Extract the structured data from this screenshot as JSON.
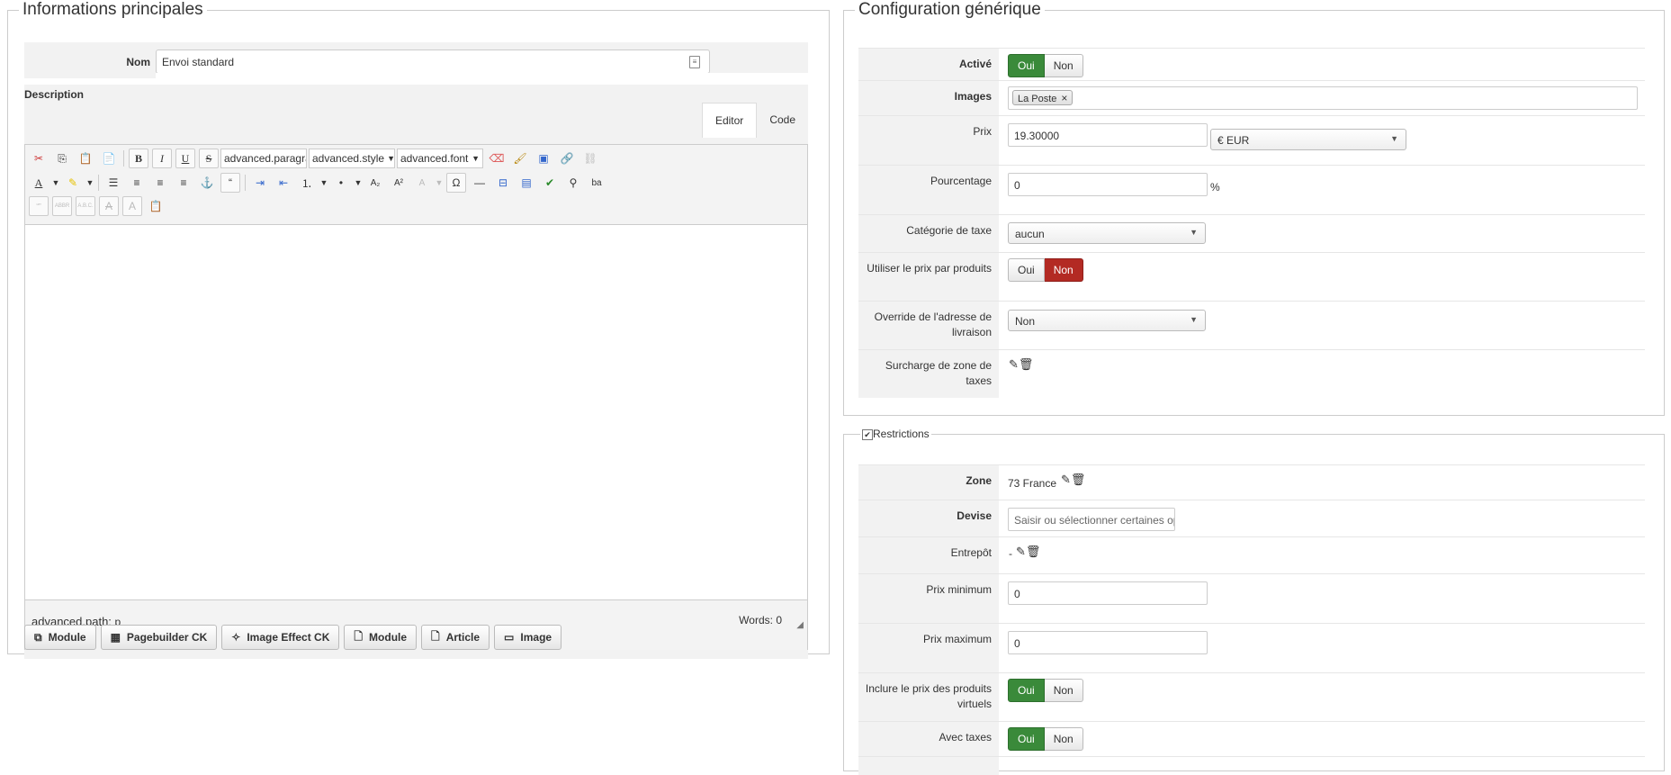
{
  "left": {
    "legend": "Informations principales",
    "nom_label": "Nom",
    "nom_value": "Envoi standard",
    "description_label": "Description",
    "tabs": [
      "Editor",
      "Code"
    ],
    "toolbar": {
      "dd1": "advanced.paragraph",
      "dd2": "advanced.style",
      "dd3": "advanced.font"
    },
    "status_path_label": "advanced.path:",
    "status_path_value": "p",
    "words_label": "Words:",
    "words_value": "0",
    "buttons": [
      "Module",
      "Pagebuilder CK",
      "Image Effect CK",
      "Module",
      "Article",
      "Image"
    ]
  },
  "gen": {
    "legend": "Configuration générique",
    "active_label": "Activé",
    "active_yes": "Oui",
    "active_no": "Non",
    "images_label": "Images",
    "images_tag": "La Poste",
    "prix_label": "Prix",
    "prix_value": "19.30000",
    "currency": "€ EUR",
    "pct_label": "Pourcentage",
    "pct_value": "0",
    "pct_unit": "%",
    "taxcat_label": "Catégorie de taxe",
    "taxcat_value": "aucun",
    "perprod_label": "Utiliser le prix par produits",
    "perprod_yes": "Oui",
    "perprod_no": "Non",
    "override_label": "Override de l'adresse de livraison",
    "override_value": "Non",
    "surcharge_label": "Surcharge de zone de taxes"
  },
  "restr": {
    "legend": "Restrictions",
    "zone_label": "Zone",
    "zone_value": "73 France",
    "devise_label": "Devise",
    "devise_placeholder": "Saisir ou sélectionner certaines options",
    "entrepot_label": "Entrepôt",
    "entrepot_value": "-",
    "prixmin_label": "Prix minimum",
    "prixmin_value": "0",
    "prixmax_label": "Prix maximum",
    "prixmax_value": "0",
    "virtual_label": "Inclure le prix des produits virtuels",
    "virtual_yes": "Oui",
    "virtual_no": "Non",
    "taxes_label": "Avec taxes",
    "taxes_yes": "Oui",
    "taxes_no": "Non"
  },
  "colors": {
    "toggle_green": "#3a8a3a",
    "toggle_red": "#b32a23",
    "label_bg": "#f2f2f2"
  }
}
